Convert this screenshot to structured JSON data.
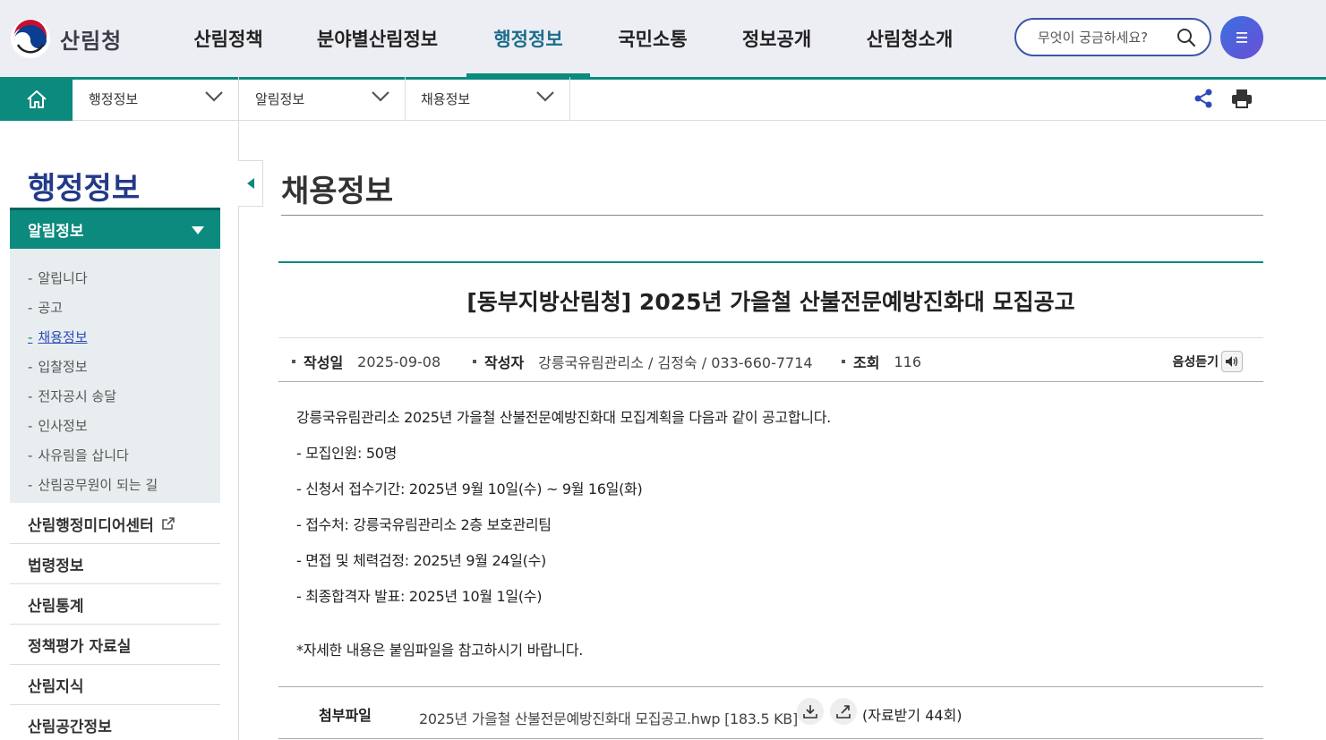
{
  "header": {
    "logo_text": "산림청",
    "nav": [
      {
        "label": "산림정책"
      },
      {
        "label": "분야별산림정보"
      },
      {
        "label": "행정정보",
        "active": true
      },
      {
        "label": "국민소통"
      },
      {
        "label": "정보공개"
      },
      {
        "label": "산림청소개"
      }
    ],
    "search_placeholder": "무엇이 궁금하세요?"
  },
  "breadcrumb": {
    "items": [
      {
        "label": "행정정보"
      },
      {
        "label": "알림정보"
      },
      {
        "label": "채용정보"
      }
    ]
  },
  "sidebar": {
    "title": "행정정보",
    "active_menu": "알림정보",
    "sub_items": [
      {
        "label": "알립니다"
      },
      {
        "label": "공고"
      },
      {
        "label": "채용정보",
        "current": true
      },
      {
        "label": "입찰정보"
      },
      {
        "label": "전자공시 송달"
      },
      {
        "label": "인사정보"
      },
      {
        "label": "사유림을 삽니다"
      },
      {
        "label": "산림공무원이 되는 길"
      }
    ],
    "menu_items": [
      {
        "label": "산림행정미디어센터",
        "external": true
      },
      {
        "label": "법령정보"
      },
      {
        "label": "산림통계"
      },
      {
        "label": "정책평가 자료실"
      },
      {
        "label": "산림지식"
      },
      {
        "label": "산림공간정보"
      }
    ]
  },
  "content": {
    "page_title": "채용정보",
    "post_title": "[동부지방산림청] 2025년 가을철 산불전문예방진화대 모집공고",
    "meta": {
      "date_label": "작성일",
      "date": "2025-09-08",
      "author_label": "작성자",
      "author": "강릉국유림관리소 / 김정숙 / 033-660-7714",
      "views_label": "조회",
      "views": "116",
      "tts_label": "음성듣기"
    },
    "body": [
      "강릉국유림관리소 2025년 가을철 산불전문예방진화대 모집계획을 다음과 같이 공고합니다.",
      "- 모집인원: 50명",
      "- 신청서 접수기간: 2025년 9월 10일(수) ~ 9월 16일(화)",
      "- 접수처: 강릉국유림관리소 2층 보호관리팀",
      "- 면접 및 체력검정: 2025년 9월 24일(수)",
      "- 최종합격자 발표: 2025년 10월 1일(수)",
      "*자세한 내용은 붙임파일을 참고하시기 바랍니다."
    ],
    "attachment": {
      "label": "첨부파일",
      "file": "2025년 가을철 산불전문예방진화대 모집공고.hwp [183.5 KB]",
      "download_count": "(자료받기 44회)"
    }
  }
}
